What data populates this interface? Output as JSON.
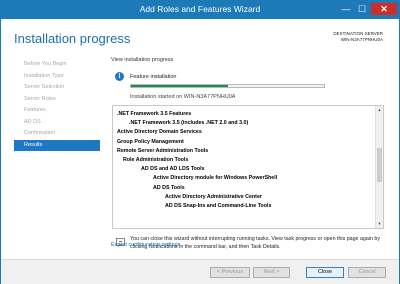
{
  "window": {
    "title": "Add Roles and Features Wizard",
    "min_glyph": "—",
    "max_glyph": "☐",
    "close_glyph": "✕"
  },
  "header": {
    "title": "Installation progress",
    "dest_label": "DESTINATION SERVER",
    "dest_server": "WIN-N3A77PNHU0A"
  },
  "nav": {
    "items": [
      {
        "label": "Before You Begin",
        "active": false
      },
      {
        "label": "Installation Type",
        "active": false
      },
      {
        "label": "Server Selection",
        "active": false
      },
      {
        "label": "Server Roles",
        "active": false
      },
      {
        "label": "Features",
        "active": false
      },
      {
        "label": "AD DS",
        "active": false
      },
      {
        "label": "Confirmation",
        "active": false
      },
      {
        "label": "Results",
        "active": true
      }
    ]
  },
  "main": {
    "view_label": "View installation progress",
    "info_icon": "i",
    "feature_label": "Feature installation",
    "progress_fraction": 0.5,
    "started_text": "Installation started on WIN-N3A77PNHU0A",
    "list": [
      {
        "text": ".NET Framework 3.5 Features",
        "level": 0,
        "bold": true
      },
      {
        "text": ".NET Framework 3.5 (includes .NET 2.0 and 3.0)",
        "level": 2,
        "bold": true
      },
      {
        "text": "Active Directory Domain Services",
        "level": 0,
        "bold": true
      },
      {
        "text": "Group Policy Management",
        "level": 0,
        "bold": true
      },
      {
        "text": "Remote Server Administration Tools",
        "level": 0,
        "bold": true
      },
      {
        "text": "Role Administration Tools",
        "level": 1,
        "bold": true
      },
      {
        "text": "AD DS and AD LDS Tools",
        "level": 3,
        "bold": true
      },
      {
        "text": "Active Directory module for Windows PowerShell",
        "level": 4,
        "bold": true
      },
      {
        "text": "AD DS Tools",
        "level": 4,
        "bold": true
      },
      {
        "text": "Active Directory Administrative Center",
        "level": 5,
        "bold": true
      },
      {
        "text": "AD DS Snap-Ins and Command-Line Tools",
        "level": 5,
        "bold": true
      }
    ],
    "note": "You can close this wizard without interrupting running tasks. View task progress or open this page again by clicking Notifications in the command bar, and then Task Details.",
    "export_link": "Export configuration settings"
  },
  "footer": {
    "prev": "< Previous",
    "next": "Next >",
    "close": "Close",
    "cancel": "Cancel"
  },
  "colors": {
    "accent": "#1c7ab9",
    "active_nav": "#1e78c3",
    "progress": "#1e8f54",
    "link": "#1e64b4"
  }
}
